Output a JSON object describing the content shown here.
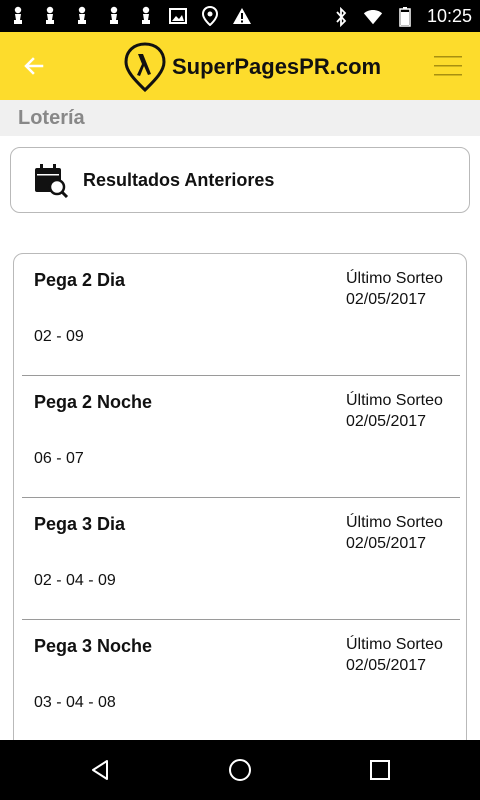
{
  "status_bar": {
    "time": "10:25",
    "left_icons": [
      "chess-pawn-icon",
      "chess-pawn-icon",
      "chess-pawn-icon",
      "chess-pawn-icon",
      "chess-pawn-icon",
      "image-icon",
      "location-icon",
      "warning-icon"
    ],
    "right_icons": [
      "bluetooth-icon",
      "wifi-icon",
      "battery-icon"
    ]
  },
  "app_bar": {
    "logo_text": "SuperPagesPR.com",
    "colors": {
      "background": "#FDDC2C"
    }
  },
  "section": {
    "title": "Lotería"
  },
  "results_button": {
    "label": "Resultados Anteriores",
    "icon": "calendar-search-icon"
  },
  "lottery_rows": [
    {
      "name": "Pega 2 Dia",
      "last_label": "Último Sorteo",
      "last_date": "02/05/2017",
      "numbers": "02 - 09"
    },
    {
      "name": "Pega 2 Noche",
      "last_label": "Último Sorteo",
      "last_date": "02/05/2017",
      "numbers": "06 - 07"
    },
    {
      "name": "Pega 3 Dia",
      "last_label": "Último Sorteo",
      "last_date": "02/05/2017",
      "numbers": "02 - 04 - 09"
    },
    {
      "name": "Pega 3 Noche",
      "last_label": "Último Sorteo",
      "last_date": "02/05/2017",
      "numbers": "03 - 04 - 08"
    }
  ],
  "nav_bar": {
    "buttons": [
      "back-triangle-icon",
      "home-circle-icon",
      "recents-square-icon"
    ]
  }
}
